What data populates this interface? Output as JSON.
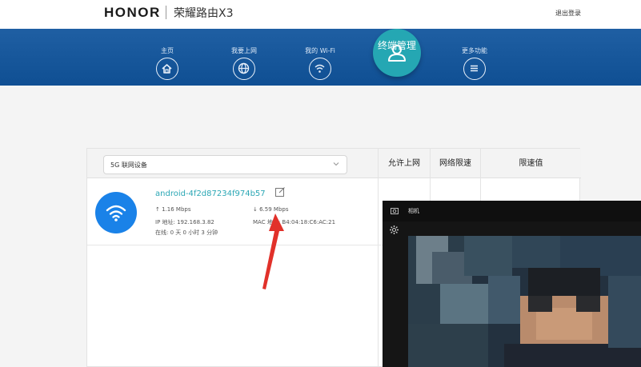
{
  "header": {
    "brand": "HONOR",
    "model": "荣耀路由X3",
    "logout_label": "退出登录"
  },
  "nav": {
    "items": [
      {
        "label": "主页",
        "icon": "home-icon"
      },
      {
        "label": "我要上网",
        "icon": "globe-icon"
      },
      {
        "label": "我的 Wi-Fi",
        "icon": "wifi-icon"
      },
      {
        "label": "终端管理",
        "icon": "user-icon",
        "active": true
      },
      {
        "label": "更多功能",
        "icon": "menu-icon"
      }
    ]
  },
  "devices": {
    "filter_selected": "5G 联网设备",
    "columns": [
      "允许上网",
      "网络限速",
      "限速值"
    ],
    "rows": [
      {
        "name": "android-4f2d87234f974b57",
        "upload": "1.16 Mbps",
        "download": "6.59 Mbps",
        "ip_label": "IP 地址: 192.168.3.82",
        "mac_label": "MAC 地址: B4:04:18:C6:AC:21",
        "online_label": "在线: 0 天 0 小时 3 分钟"
      }
    ]
  },
  "camera": {
    "title": "相机"
  },
  "colors": {
    "nav_band": "#1f5fa3",
    "active_circle": "#25a7b3",
    "device_name": "#2ba7b5",
    "wifi_badge": "#1a82e8",
    "arrow": "#e1312a"
  }
}
